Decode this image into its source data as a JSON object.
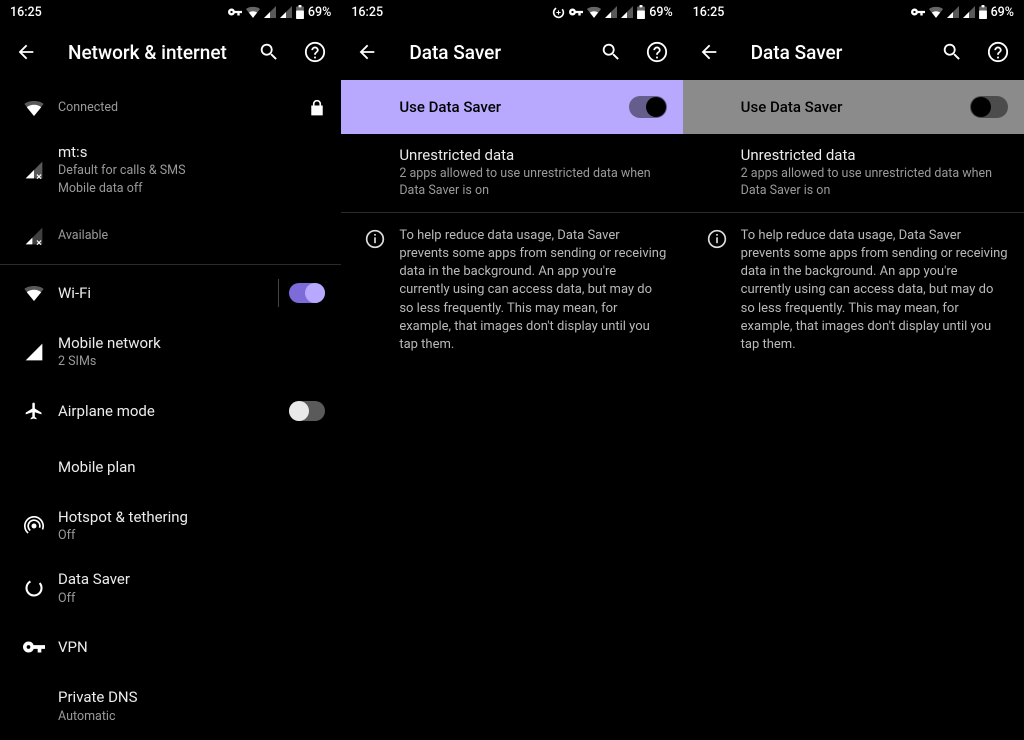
{
  "status": {
    "time": "16:25",
    "battery": "69%"
  },
  "pane1": {
    "title": "Network & internet",
    "connected": "Connected",
    "sim1_name": "mt:s",
    "sim1_line1": "Default for calls & SMS",
    "sim1_line2": "Mobile data off",
    "sim2_status": "Available",
    "wifi": "Wi-Fi",
    "mobile_network": "Mobile network",
    "mobile_network_sub": "2 SIMs",
    "airplane": "Airplane mode",
    "mobile_plan": "Mobile plan",
    "hotspot": "Hotspot & tethering",
    "hotspot_sub": "Off",
    "data_saver": "Data Saver",
    "data_saver_sub": "Off",
    "vpn": "VPN",
    "private_dns": "Private DNS",
    "private_dns_sub": "Automatic"
  },
  "ds": {
    "title": "Data Saver",
    "use_label": "Use Data Saver",
    "unrestricted": "Unrestricted data",
    "unrestricted_sub": "2 apps allowed to use unrestricted data when Data Saver is on",
    "info": "To help reduce data usage, Data Saver prevents some apps from sending or receiving data in the background. An app you're currently using can access data, but may do so less frequently. This may mean, for example, that images don't display until you tap them."
  }
}
